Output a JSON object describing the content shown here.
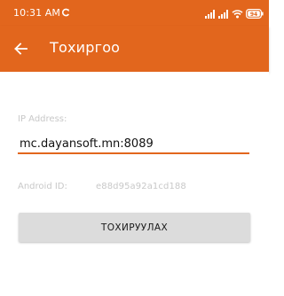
{
  "status_bar": {
    "time": "10:31 AM",
    "icons": [
      "sync-icon",
      "signal-icon",
      "signal-icon",
      "wifi-icon",
      "battery-icon"
    ],
    "battery_level": "94",
    "background_color": "#e2661d"
  },
  "app_bar": {
    "title": "Тохиргоо",
    "back_icon": "arrow-left-icon",
    "background_color": "#e2661d"
  },
  "form": {
    "ip_label": "IP Address:",
    "ip_value": "mc.dayansoft.mn:8089",
    "android_id_label": "Android ID:",
    "android_id_value": "e88d95a92a1cd188",
    "submit_label": "ТОХИРУУЛАХ",
    "accent_color": "#e2661d"
  }
}
